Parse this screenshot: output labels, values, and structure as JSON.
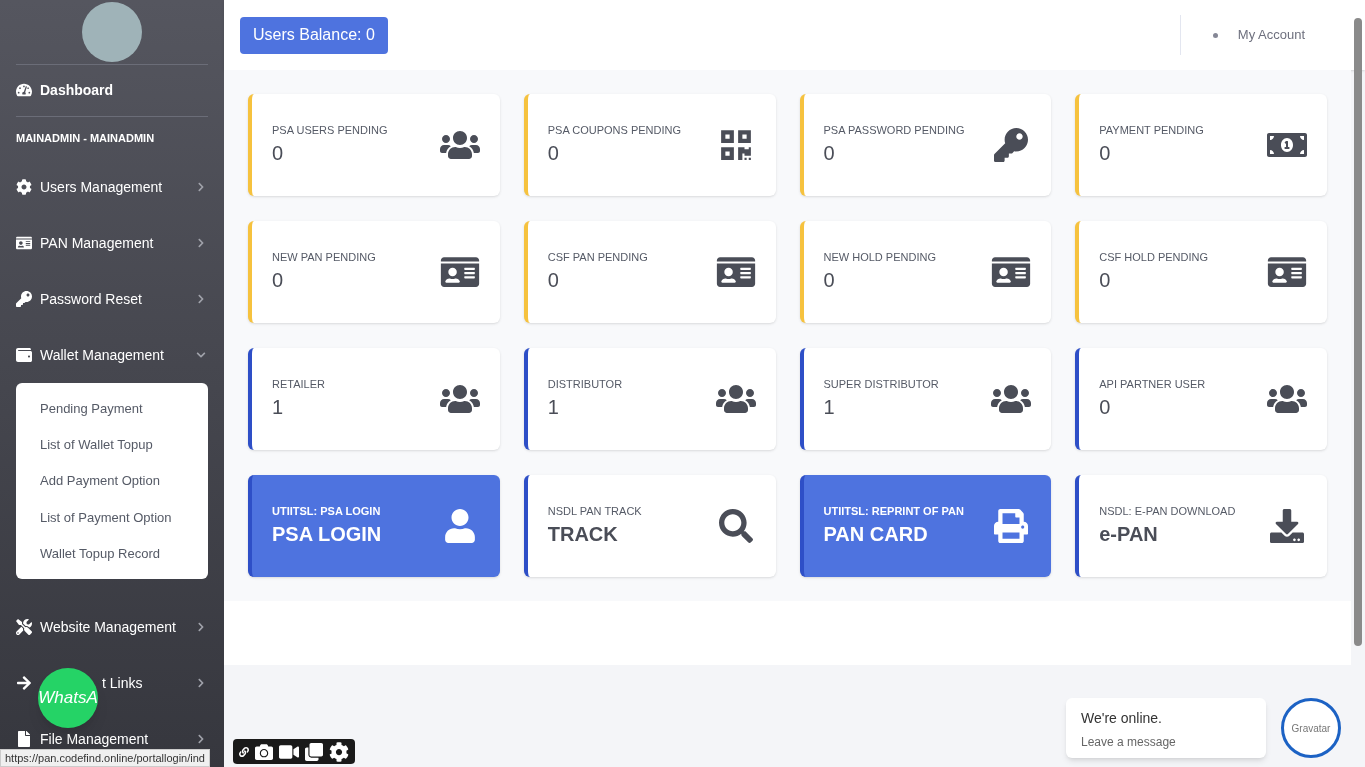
{
  "sidebar": {
    "items": [
      {
        "kind": "link",
        "label": "Dashboard"
      },
      {
        "kind": "heading",
        "label": "MAINADMIN - MAINADMIN"
      },
      {
        "kind": "menu",
        "label": "Users Management",
        "expanded": false
      },
      {
        "kind": "menu",
        "label": "PAN Management",
        "expanded": false
      },
      {
        "kind": "menu",
        "label": "Password Reset",
        "expanded": false
      },
      {
        "kind": "menu",
        "label": "Wallet Management",
        "expanded": true,
        "children": [
          {
            "label": "Pending Payment"
          },
          {
            "label": "List of Wallet Topup"
          },
          {
            "label": "Add Payment Option"
          },
          {
            "label": "List of Payment Option"
          },
          {
            "label": "Wallet Topup Record"
          }
        ]
      },
      {
        "kind": "menu",
        "label": "Website Management",
        "expanded": false
      },
      {
        "kind": "menu",
        "label": "t Links",
        "expanded": false
      },
      {
        "kind": "menu",
        "label": "File Management",
        "expanded": false
      }
    ]
  },
  "topbar": {
    "balance": "Users Balance: 0",
    "account": "My Account"
  },
  "cards": [
    {
      "kind": "stat",
      "label": "PSA USERS PENDING",
      "value": "0",
      "color": "#f6c23e"
    },
    {
      "kind": "stat",
      "label": "PSA COUPONS PENDING",
      "value": "0",
      "color": "#f6c23e"
    },
    {
      "kind": "stat",
      "label": "PSA PASSWORD PENDING",
      "value": "0",
      "color": "#f6c23e"
    },
    {
      "kind": "stat",
      "label": "PAYMENT PENDING",
      "value": "0",
      "color": "#f6c23e"
    },
    {
      "kind": "stat",
      "label": "NEW PAN PENDING",
      "value": "0",
      "color": "#f6c23e"
    },
    {
      "kind": "stat",
      "label": "CSF PAN PENDING",
      "value": "0",
      "color": "#f6c23e"
    },
    {
      "kind": "stat",
      "label": "NEW HOLD PENDING",
      "value": "0",
      "color": "#f6c23e"
    },
    {
      "kind": "stat",
      "label": "CSF HOLD PENDING",
      "value": "0",
      "color": "#f6c23e"
    },
    {
      "kind": "stat",
      "label": "RETAILER",
      "value": "1",
      "color": "#2e4fc7"
    },
    {
      "kind": "stat",
      "label": "DISTRIBUTOR",
      "value": "1",
      "color": "#2e4fc7"
    },
    {
      "kind": "stat",
      "label": "SUPER DISTRIBUTOR",
      "value": "1",
      "color": "#2e4fc7"
    },
    {
      "kind": "stat",
      "label": "API PARTNER USER",
      "value": "0",
      "color": "#2e4fc7"
    },
    {
      "kind": "link",
      "label": "UTIITSL: PSA LOGIN",
      "value": "PSA LOGIN",
      "color": "#2e4fc7",
      "filled": true
    },
    {
      "kind": "link",
      "label": "NSDL PAN TRACK",
      "value": "TRACK",
      "color": "#2e4fc7",
      "filled": false
    },
    {
      "kind": "link",
      "label": "UTIITSL: REPRINT OF PAN",
      "value": "PAN CARD",
      "color": "#2e4fc7",
      "filled": true
    },
    {
      "kind": "link",
      "label": "NSDL: E-PAN DOWNLOAD",
      "value": "e-PAN",
      "color": "#2e4fc7",
      "filled": false
    }
  ],
  "whatsapp": {
    "label": "WhatsA"
  },
  "chat": {
    "title": "We're online.",
    "subtitle": "Leave a message",
    "avatar_alt": "Gravatar"
  },
  "status_url": "https://pan.codefind.online/portallogin/ind"
}
